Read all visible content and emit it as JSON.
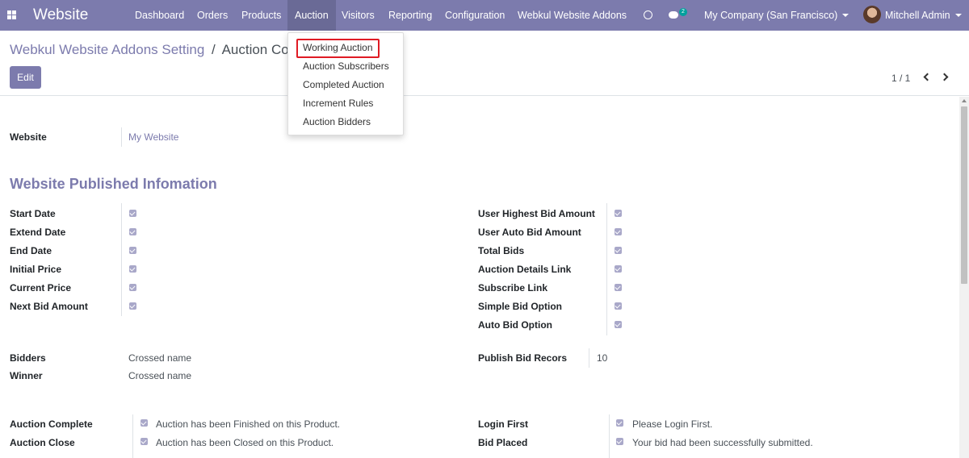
{
  "navbar": {
    "brand": "Website",
    "menu": [
      "Dashboard",
      "Orders",
      "Products",
      "Auction",
      "Visitors",
      "Reporting",
      "Configuration",
      "Webkul Website Addons"
    ],
    "active_menu": "Auction",
    "chat_count": "2",
    "company": "My Company (San Francisco)",
    "user": "Mitchell Admin",
    "color": "#7c7bad"
  },
  "breadcrumb": {
    "parent": "Webkul Website Addons Setting",
    "separator": "/",
    "current": "Auction Conf"
  },
  "toolbar": {
    "edit_label": "Edit"
  },
  "pager": {
    "value": "1 / 1"
  },
  "dropdown": {
    "items": [
      "Working Auction",
      "Auction Subscribers",
      "Completed Auction",
      "Increment Rules",
      "Auction Bidders"
    ],
    "highlighted": "Working Auction"
  },
  "form": {
    "website_label": "Website",
    "website_value": "My Website",
    "section_title": "Website Published Infomation",
    "left_checks": [
      "Start Date",
      "Extend Date",
      "End Date",
      "Initial Price",
      "Current Price",
      "Next Bid Amount"
    ],
    "right_checks": [
      "User Highest Bid Amount",
      "User Auto Bid Amount",
      "Total Bids",
      "Auction Details Link",
      "Subscribe Link",
      "Simple Bid Option",
      "Auto Bid Option"
    ],
    "bidders_label": "Bidders",
    "bidders_value": "Crossed name",
    "winner_label": "Winner",
    "winner_value": "Crossed name",
    "publish_label": "Publish Bid Recors",
    "publish_value": "10",
    "messages_left": [
      {
        "label": "Auction Complete",
        "message": "Auction has been Finished on this Product."
      },
      {
        "label": "Auction Close",
        "message": "Auction has been Closed on this Product."
      }
    ],
    "messages_right": [
      {
        "label": "Login First",
        "message": "Please Login First."
      },
      {
        "label": "Bid Placed",
        "message": "Your bid had been successfully submitted."
      }
    ]
  }
}
